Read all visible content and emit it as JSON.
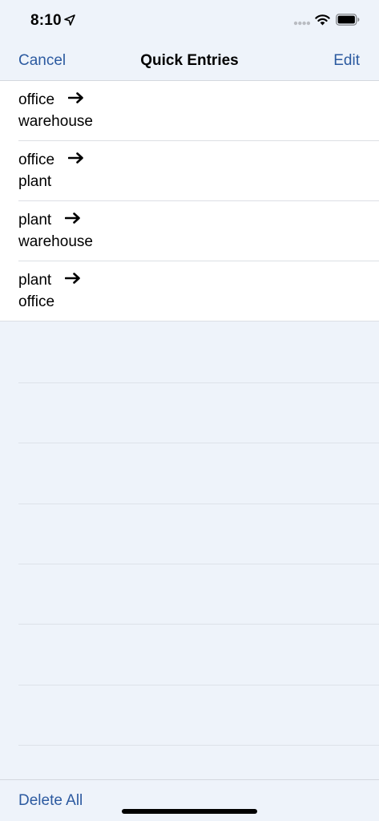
{
  "status_bar": {
    "time": "8:10",
    "icons": [
      "location-arrow-icon",
      "cellular-signal-icon",
      "wifi-icon",
      "battery-icon"
    ]
  },
  "nav": {
    "cancel_label": "Cancel",
    "title": "Quick Entries",
    "edit_label": "Edit"
  },
  "entries": [
    {
      "from": "office",
      "to": "warehouse"
    },
    {
      "from": "office",
      "to": "plant"
    },
    {
      "from": "plant",
      "to": "warehouse"
    },
    {
      "from": "plant",
      "to": "office"
    }
  ],
  "toolbar": {
    "delete_all_label": "Delete All"
  },
  "colors": {
    "accent": "#2c5aa0",
    "background": "#eef3fa",
    "row_background": "#ffffff",
    "separator": "#dcdfe4"
  }
}
